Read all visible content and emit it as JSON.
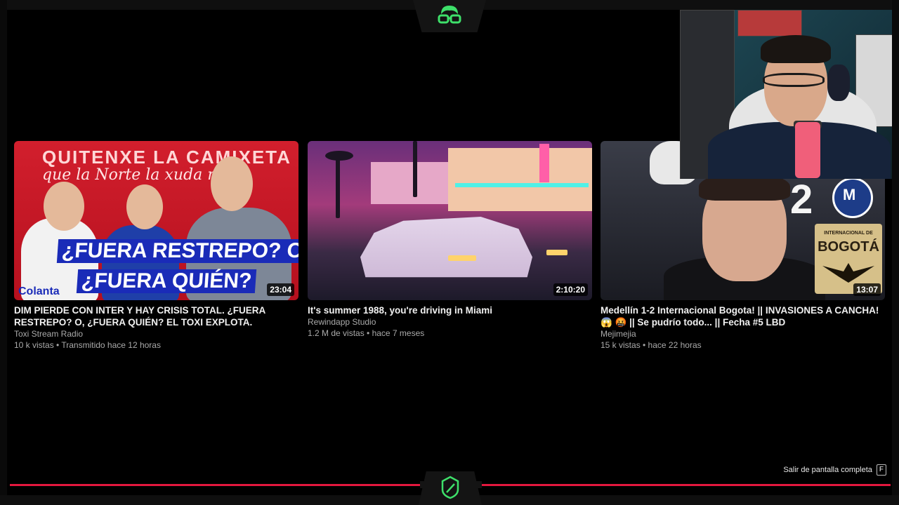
{
  "videos": [
    {
      "title": "DIM PIERDE CON INTER Y HAY CRISIS TOTAL. ¿FUERA RESTREPO? O, ¿FUERA QUIÉN? EL TOXI EXPLOTA.",
      "channel": "Toxi Stream Radio",
      "meta": "10 k vistas • Transmitido hace 12 horas",
      "duration": "23:04",
      "thumb_text_1": "QUITENXE LA CAMIXETA",
      "thumb_text_2": "que la Norte la xuda más!",
      "thumb_caption_1": "¿FUERA RESTREPO?  O,",
      "thumb_caption_2": "¿FUERA QUIÉN?",
      "thumb_sponsor": "Colanta"
    },
    {
      "title": "It's summer 1988, you're driving in Miami",
      "channel": "Rewindapp Studio",
      "meta": "1.2 M de vistas • hace 7 meses",
      "duration": "2:10:20"
    },
    {
      "title": "Medellín 1-2 Internacional Bogota! || INVASIONES A CANCHA!😱 🤬 || Se pudrío todo... || Fecha #5 LBD",
      "channel": "Mejimejia",
      "meta": "15 k vistas • hace 22 horas",
      "duration": "13:07",
      "thumb_badge_1": "INTERNACIONAL DE",
      "thumb_badge_2": "BOGOTÁ",
      "thumb_number": "2",
      "thumb_letter": "M"
    }
  ],
  "player": {
    "exit_fullscreen_label": "Salir de pantalla completa",
    "exit_fullscreen_key": "F",
    "progress_color": "#e3173e"
  },
  "icons": {
    "top_logo": "streamer-glasses-logo-icon",
    "bottom_logo": "shield-logo-icon"
  }
}
